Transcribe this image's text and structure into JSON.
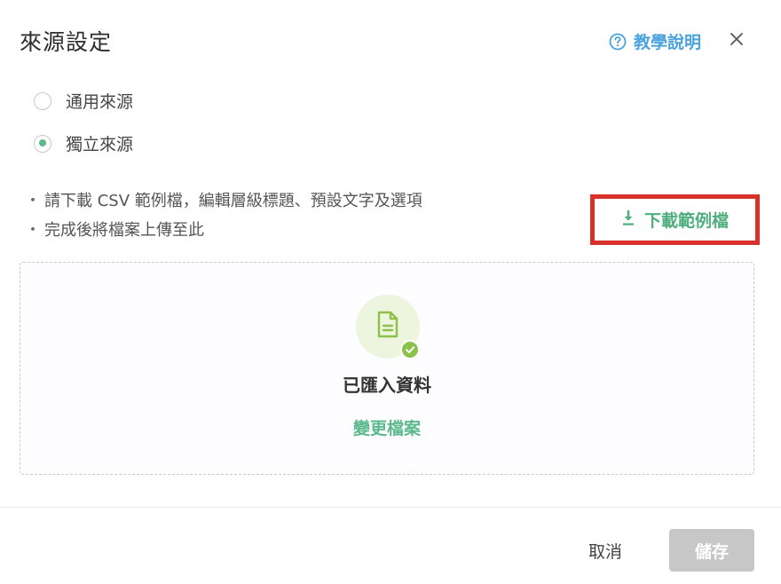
{
  "dialog": {
    "title": "來源設定",
    "help_label": "教學說明"
  },
  "radios": [
    {
      "label": "通用來源",
      "checked": false
    },
    {
      "label": "獨立來源",
      "checked": true
    }
  ],
  "instructions": {
    "bullet": "・",
    "lines": [
      "請下載 CSV 範例檔，編輯層級標題、預設文字及選項",
      "完成後將檔案上傳至此"
    ]
  },
  "download": {
    "label": "下載範例檔"
  },
  "upload": {
    "status": "已匯入資料",
    "change_label": "變更檔案"
  },
  "footer": {
    "cancel_label": "取消",
    "save_label": "儲存"
  },
  "colors": {
    "accent_green": "#5bb98b",
    "help_blue": "#4aa3df",
    "highlight_red": "#d8302b",
    "disabled_gray": "#c7c7c7"
  }
}
